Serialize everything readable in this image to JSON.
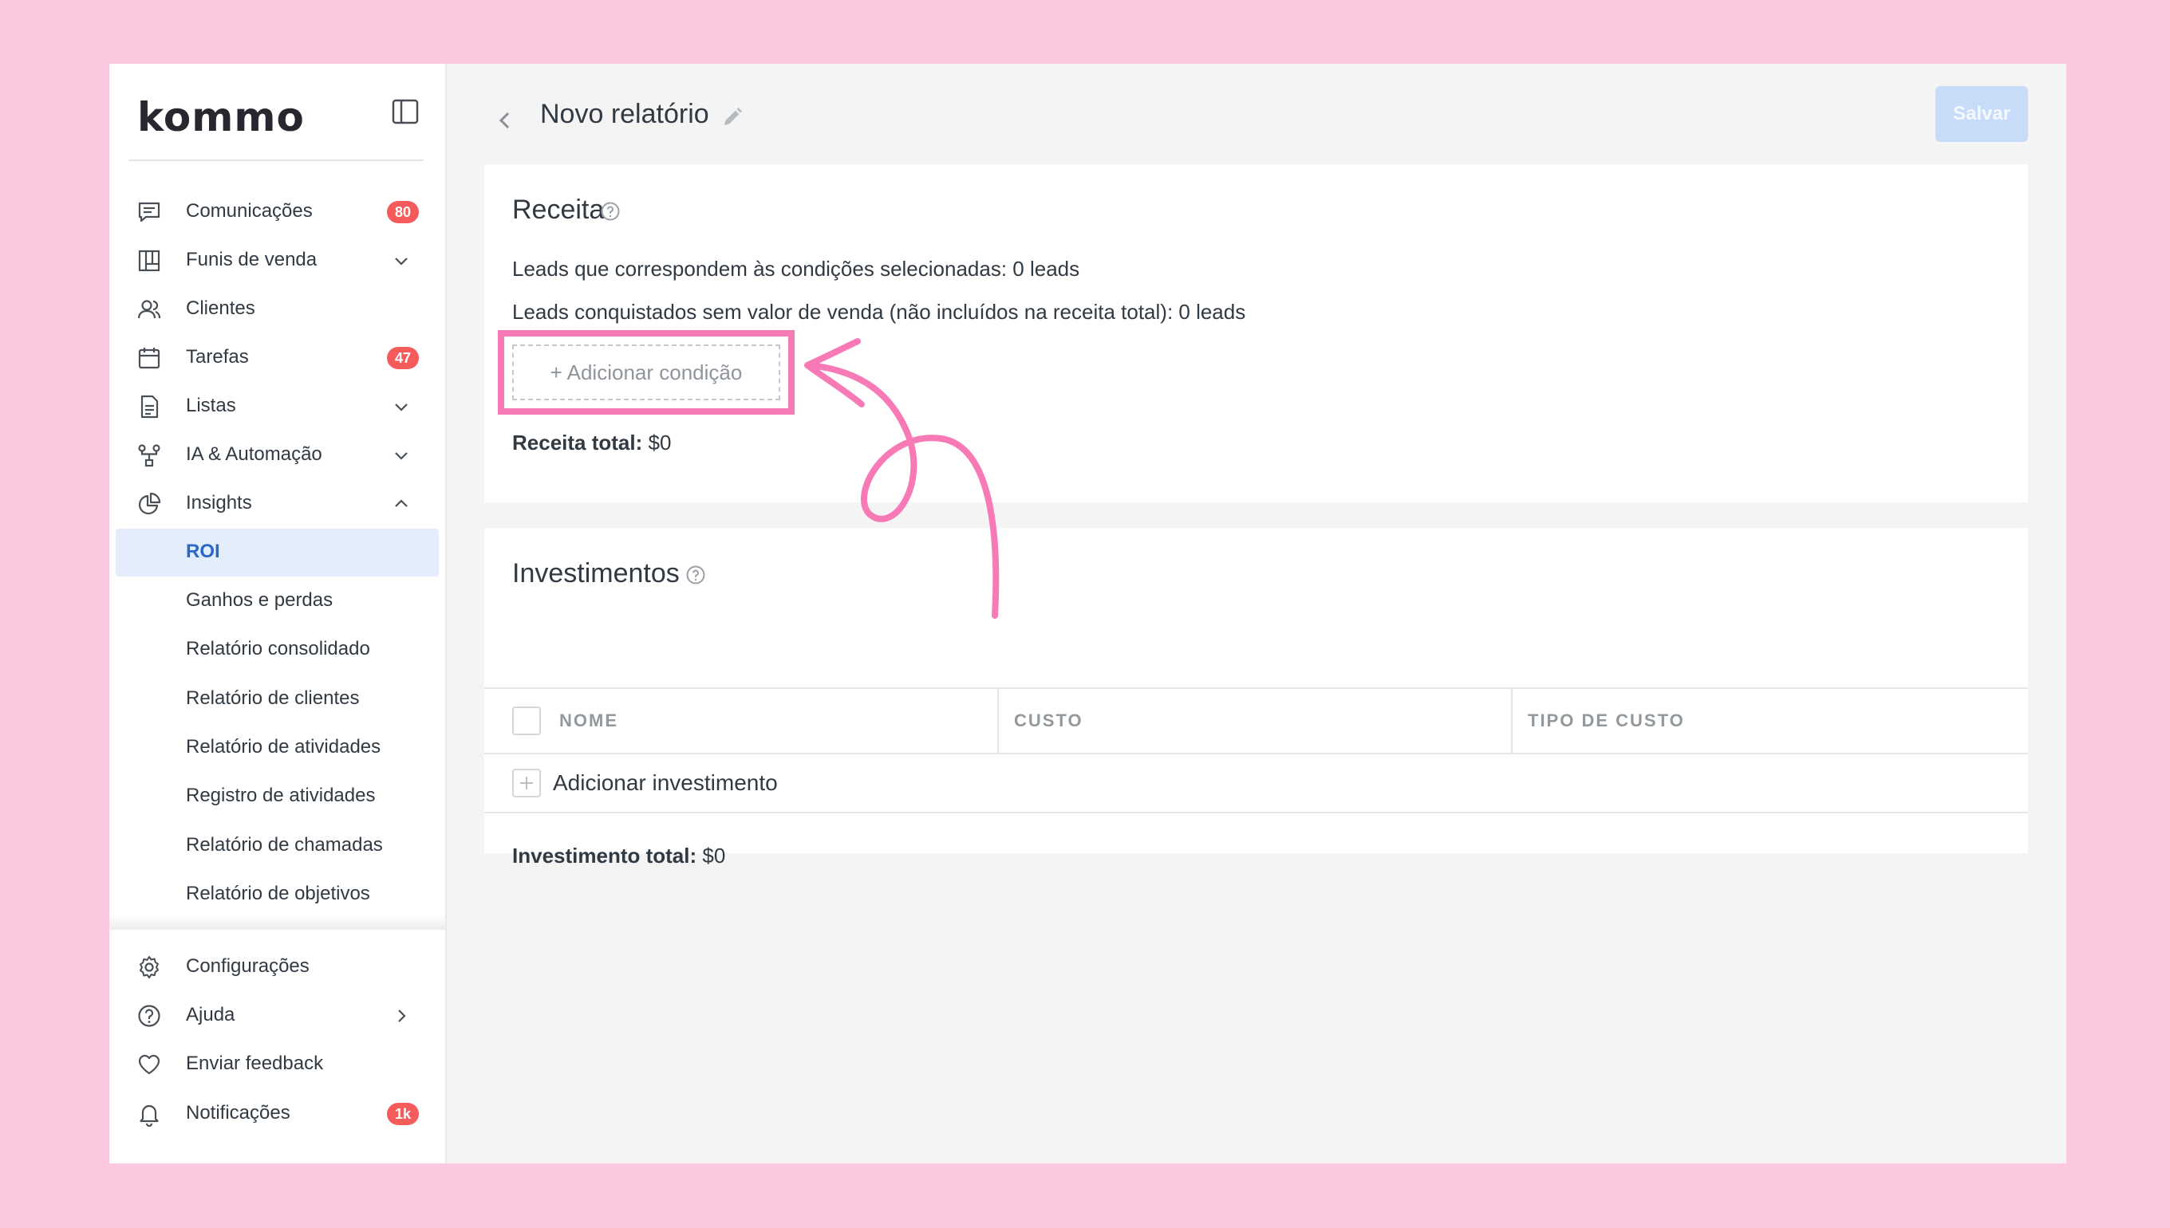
{
  "brand": {
    "logo_text": "kommo"
  },
  "sidebar": {
    "items": [
      {
        "label": "Comunicações",
        "badge": "80",
        "icon": "chat-icon"
      },
      {
        "label": "Funis de venda",
        "icon": "kanban-icon",
        "has_chevron": true
      },
      {
        "label": "Clientes",
        "icon": "users-icon"
      },
      {
        "label": "Tarefas",
        "badge": "47",
        "icon": "calendar-icon"
      },
      {
        "label": "Listas",
        "icon": "document-icon",
        "has_chevron": true
      },
      {
        "label": "IA & Automação",
        "icon": "automation-icon",
        "has_chevron": true
      },
      {
        "label": "Insights",
        "icon": "pie-chart-icon",
        "expanded": true
      }
    ],
    "sub_items": [
      {
        "label": "ROI",
        "active": true
      },
      {
        "label": "Ganhos e perdas"
      },
      {
        "label": "Relatório consolidado"
      },
      {
        "label": "Relatório de clientes"
      },
      {
        "label": "Relatório de atividades"
      },
      {
        "label": "Registro de atividades"
      },
      {
        "label": "Relatório de chamadas"
      },
      {
        "label": "Relatório de objetivos"
      }
    ],
    "bottom_items": [
      {
        "label": "Configurações",
        "icon": "gear-icon"
      },
      {
        "label": "Ajuda",
        "icon": "help-icon",
        "has_chevron": true
      },
      {
        "label": "Enviar feedback",
        "icon": "heart-icon"
      },
      {
        "label": "Notificações",
        "icon": "bell-icon",
        "badge": "1k"
      }
    ]
  },
  "header": {
    "title": "Novo relatório",
    "save_label": "Salvar"
  },
  "receita": {
    "title": "Receita",
    "line1": "Leads que correspondem às condições selecionadas: 0 leads",
    "line2": "Leads conquistados sem valor de venda (não incluídos na receita total): 0 leads",
    "add_condition": "+ Adicionar condição",
    "total_label": "Receita total:",
    "total_value": "$0"
  },
  "investimentos": {
    "title": "Investimentos",
    "columns": [
      "NOME",
      "CUSTO",
      "TIPO DE CUSTO"
    ],
    "add_label": "Adicionar investimento",
    "total_label": "Investimento total:",
    "total_value": "$0"
  },
  "colors": {
    "accent": "#2c67c8",
    "badge": "#f55b5b",
    "highlight": "#f77ab7",
    "background": "#fcc8e0"
  }
}
